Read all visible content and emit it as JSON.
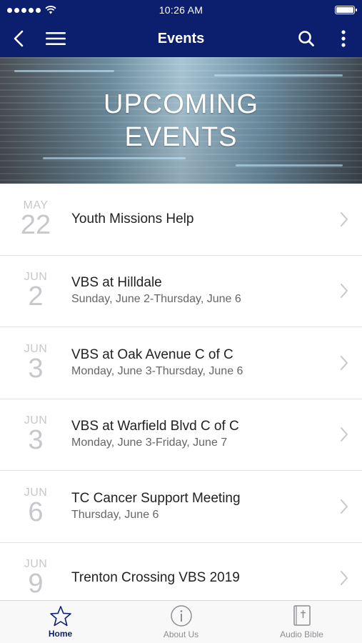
{
  "statusbar": {
    "time": "10:26 AM"
  },
  "navbar": {
    "title": "Events"
  },
  "banner": {
    "line1": "UPCOMING",
    "line2": "EVENTS"
  },
  "events": [
    {
      "month": "MAY",
      "day": "22",
      "title": "Youth Missions Help",
      "subtitle": ""
    },
    {
      "month": "JUN",
      "day": "2",
      "title": "VBS at Hilldale",
      "subtitle": "Sunday, June 2-Thursday, June 6"
    },
    {
      "month": "JUN",
      "day": "3",
      "title": "VBS at Oak Avenue C of C",
      "subtitle": "Monday, June 3-Thursday, June 6"
    },
    {
      "month": "JUN",
      "day": "3",
      "title": "VBS at Warfield Blvd C of C",
      "subtitle": "Monday, June 3-Friday, June 7"
    },
    {
      "month": "JUN",
      "day": "6",
      "title": "TC Cancer Support Meeting",
      "subtitle": "Thursday, June 6"
    },
    {
      "month": "JUN",
      "day": "9",
      "title": "Trenton Crossing VBS 2019",
      "subtitle": ""
    }
  ],
  "tabs": [
    {
      "label": "Home",
      "icon": "star-icon",
      "active": true
    },
    {
      "label": "About Us",
      "icon": "info-icon",
      "active": false
    },
    {
      "label": "Audio Bible",
      "icon": "bible-icon",
      "active": false
    }
  ],
  "colors": {
    "navbar": "#0b1f6e",
    "accent": "#0b1f6e",
    "date_text": "#c7c7cc"
  }
}
